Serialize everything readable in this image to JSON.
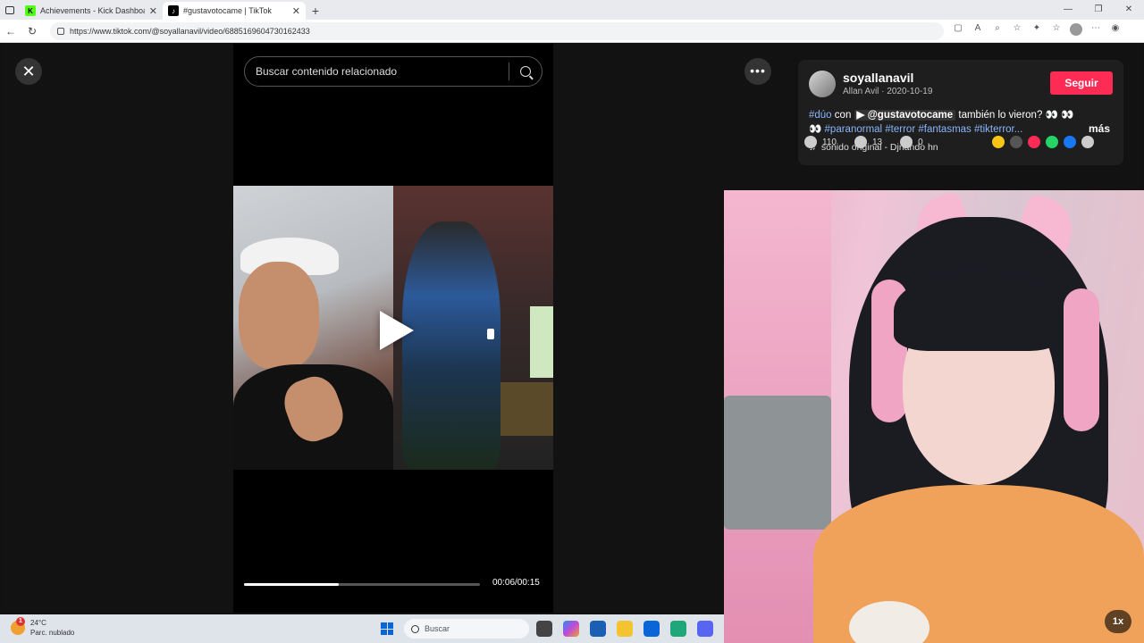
{
  "browser": {
    "tabs": [
      {
        "label": "Achievements - Kick Dashboard",
        "favicon": "kick-icon"
      },
      {
        "label": "#gustavotocame | TikTok",
        "favicon": "tiktok-icon"
      }
    ],
    "url": "https://www.tiktok.com/@soyallanavil/video/6885169604730162433"
  },
  "search": {
    "placeholder": "Buscar contenido relacionado"
  },
  "video": {
    "time": "00:06/00:15",
    "progress": 0.4
  },
  "author": {
    "username": "soyallanavil",
    "subtitle": "Allan Avil · 2020-10-19",
    "follow_label": "Seguir"
  },
  "description": {
    "tag1": "#dúo",
    "connector": "con",
    "mention": "@gustavotocame",
    "text": "también lo vieron?",
    "tags": "#paranormal #terror #fantasmas #tikterror...",
    "more_label": "más"
  },
  "sound": "sonido original - Djnando hn",
  "stats": {
    "likes": "110",
    "comments": "13",
    "saves": "0"
  },
  "overlay": {
    "speed": "1x"
  },
  "taskbar": {
    "temp": "24°C",
    "weather": "Parc. nublado",
    "weather_badge": "1",
    "search_label": "Buscar"
  },
  "colors": {
    "follow": "#fe2c55",
    "hashtag": "#8ab4f8",
    "kick": "#53fc18"
  }
}
